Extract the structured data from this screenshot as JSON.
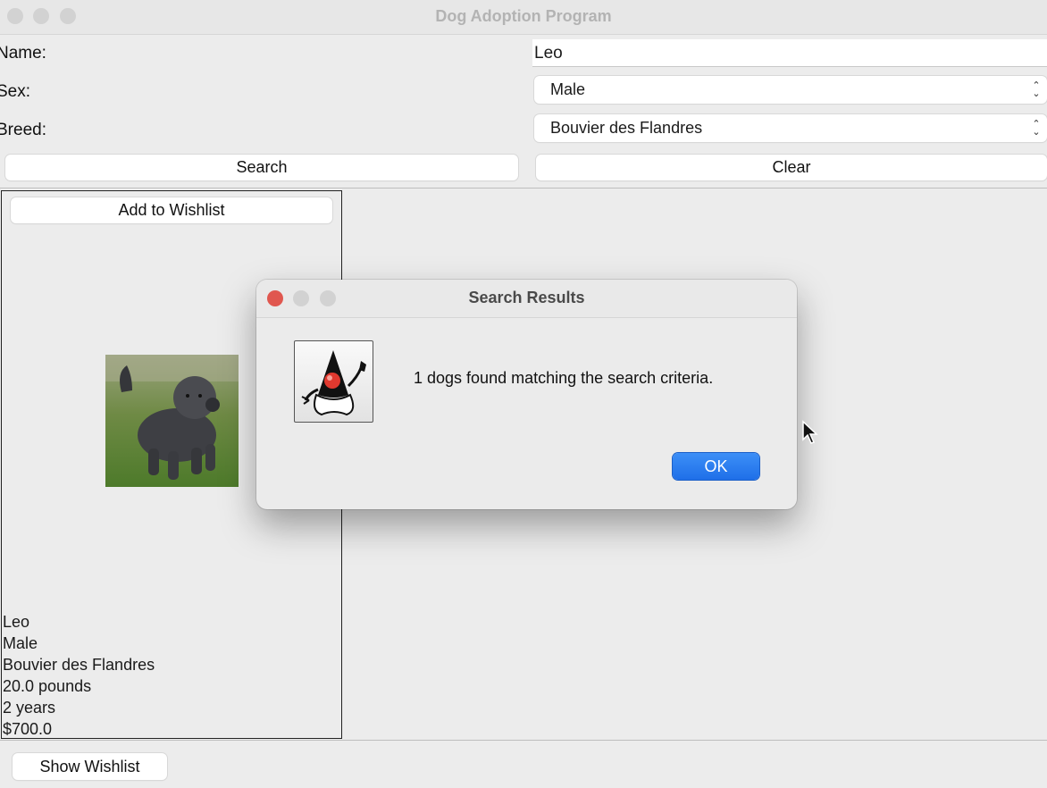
{
  "window": {
    "title": "Dog Adoption Program"
  },
  "form": {
    "name_label": "Name:",
    "name_value": "Leo",
    "sex_label": "Sex:",
    "sex_value": "Male",
    "breed_label": "Breed:",
    "breed_value": "Bouvier des Flandres",
    "search_label": "Search",
    "clear_label": "Clear"
  },
  "card": {
    "add_label": "Add to Wishlist",
    "photo_icon": "dog-photo",
    "lines": [
      "Leo",
      "Male",
      "Bouvier des Flandres",
      "20.0 pounds",
      "2 years",
      "$700.0"
    ]
  },
  "footer": {
    "show_wishlist_label": "Show Wishlist"
  },
  "dialog": {
    "title": "Search Results",
    "icon": "java-duke-icon",
    "message": "1 dogs found matching the search criteria.",
    "ok_label": "OK",
    "accent_color": "#2a7ef0"
  }
}
